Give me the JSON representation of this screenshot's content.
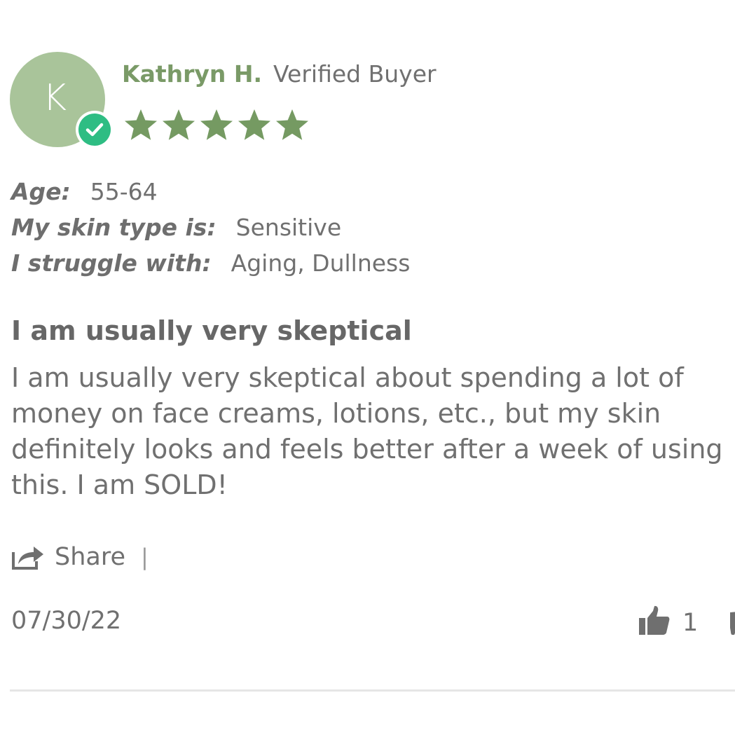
{
  "reviewer": {
    "initial": "K",
    "name": "Kathryn H.",
    "badge_text": "Verified Buyer",
    "rating": 5,
    "avatar_color": "#a9c49a",
    "name_color": "#7a9a67",
    "badge_color": "#2ebd83",
    "star_color": "#759a62"
  },
  "attributes": [
    {
      "label": "Age:",
      "value": "55-64"
    },
    {
      "label": "My skin type is:",
      "value": "Sensitive"
    },
    {
      "label": "I struggle with:",
      "value": "Aging, Dullness"
    }
  ],
  "review": {
    "title": "I am usually very skeptical",
    "body": "I am usually very skeptical about spending a lot of money on face creams, lotions, etc., but my skin definitely looks and feels better after a week of using this. I am SOLD!"
  },
  "actions": {
    "share_label": "Share",
    "separator": "|",
    "share_icon": "share-icon",
    "thumbs_up_icon": "thumbs-up-icon",
    "thumbs_down_icon": "thumbs-down-icon"
  },
  "footer": {
    "date": "07/30/22",
    "helpful_count": "1"
  }
}
